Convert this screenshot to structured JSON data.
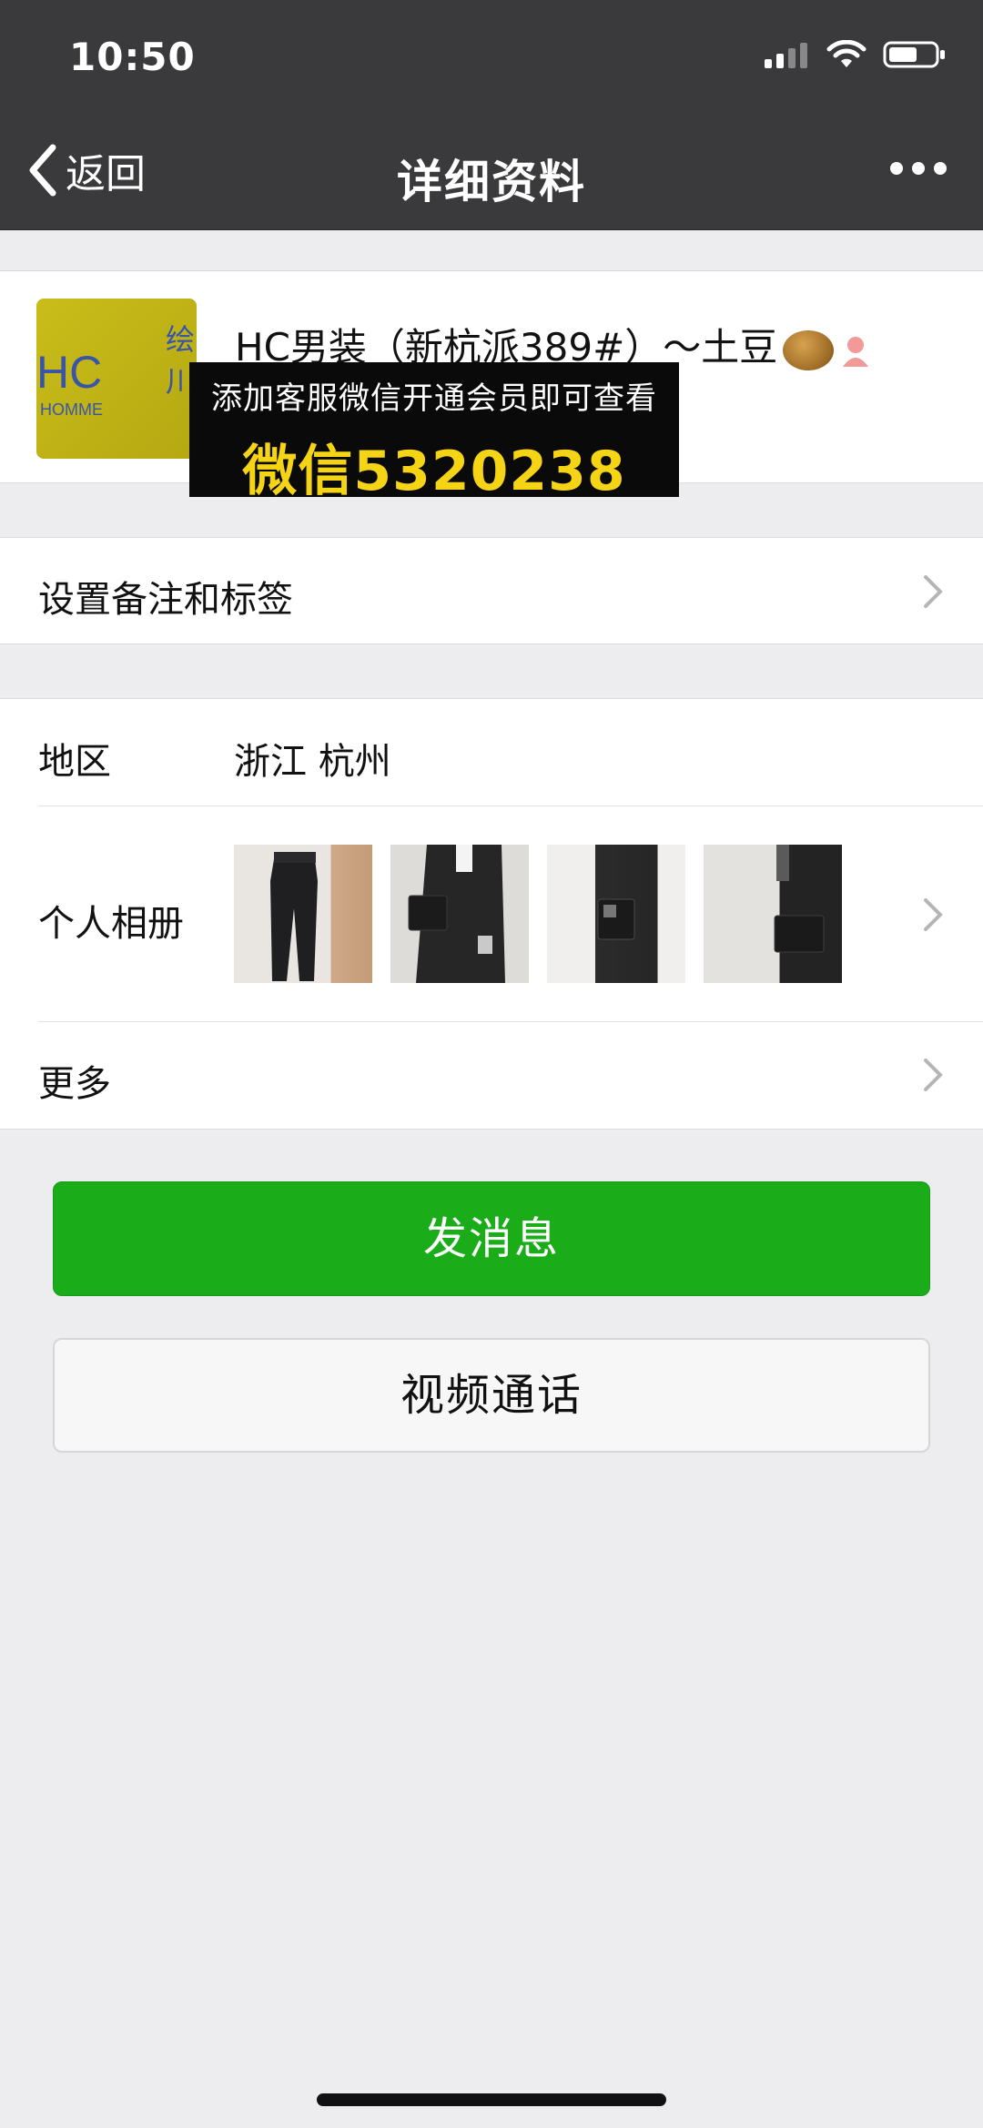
{
  "status_bar": {
    "time": "10:50"
  },
  "nav": {
    "back_label": "返回",
    "title": "详细资料"
  },
  "profile": {
    "name": "HC男装（新杭派389#）～土豆",
    "avatar_text_main": "HC",
    "avatar_text_sub": "HOMME",
    "avatar_text_side": "绘 川"
  },
  "overlay": {
    "line1": "添加客服微信开通会员即可查看",
    "line2": "微信5320238"
  },
  "rows": {
    "remark_label": "设置备注和标签",
    "region_label": "地区",
    "region_value": "浙江 杭州",
    "album_label": "个人相册",
    "more_label": "更多"
  },
  "buttons": {
    "send": "发消息",
    "video": "视频通话"
  },
  "icons": {
    "back": "chevron-left-icon",
    "more": "more-dots-icon",
    "signal": "signal-icon",
    "wifi": "wifi-icon",
    "battery": "battery-icon",
    "chevron": "chevron-right-icon"
  },
  "colors": {
    "nav_bg": "#3A3A3C",
    "send_button": "#1AAD19",
    "overlay_highlight": "#F5D315"
  }
}
